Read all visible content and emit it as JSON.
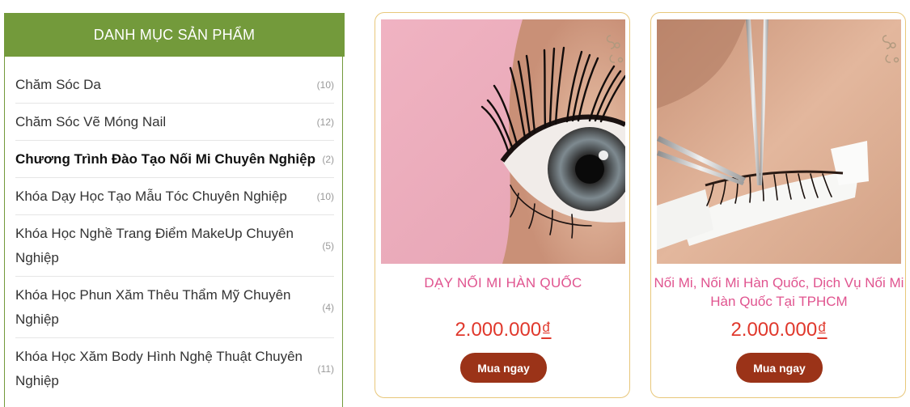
{
  "sidebar": {
    "title": "DANH MỤC SẢN PHẨM",
    "accent_color": "#739a3b",
    "categories": [
      {
        "label": "Chăm Sóc Da",
        "count": "(10)"
      },
      {
        "label": "Chăm Sóc Vẽ Móng Nail",
        "count": "(12)"
      },
      {
        "label": "Chương Trình Đào Tạo Nối Mi Chuyên Nghiệp",
        "count": "(2)"
      },
      {
        "label": "Khóa Dạy Học Tạo Mẫu Tóc Chuyên Nghiệp",
        "count": "(10)"
      },
      {
        "label": "Khóa Học Nghề Trang Điểm MakeUp Chuyên Nghiệp",
        "count": "(5)"
      },
      {
        "label": "Khóa Học Phun Xăm Thêu Thẩm Mỹ Chuyên Nghiệp",
        "count": "(4)"
      },
      {
        "label": "Khóa Học Xăm Body Hình Nghệ Thuật Chuyên Nghiệp",
        "count": "(11)"
      }
    ]
  },
  "products": [
    {
      "title": "DẠY NỐI MI HÀN QUỐC",
      "price_amount": "2.000.000",
      "price_currency": "₫",
      "button_label": "Mua ngay"
    },
    {
      "title": "Nối Mi, Nối Mi Hàn Quốc, Dịch Vụ Nối Mi Hàn Quốc Tại TPHCM",
      "price_amount": "2.000.000",
      "price_currency": "₫",
      "button_label": "Mua ngay"
    }
  ],
  "colors": {
    "title_pink": "#e0548f",
    "price_red": "#e0382c",
    "button_brown": "#9b3318",
    "card_border": "#e8c77a"
  }
}
